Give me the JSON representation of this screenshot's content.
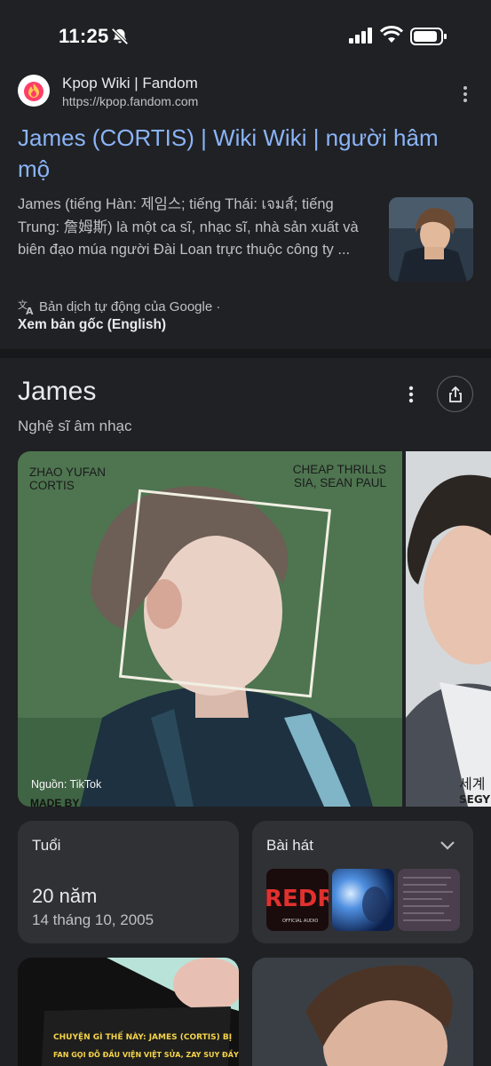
{
  "status_bar": {
    "time": "11:25",
    "icons": [
      "bell-off-icon",
      "signal-icon",
      "wifi-icon",
      "battery-icon"
    ]
  },
  "result": {
    "site_name": "Kpop Wiki | Fandom",
    "site_url": "https://kpop.fandom.com",
    "title": "James (CORTIS) | Wiki Wiki | người hâm mộ",
    "snippet": "James (tiếng Hàn: 제임스; tiếng Thái: เจมส์; tiếng Trung: 詹姆斯) là một ca sĩ, nhạc sĩ, nhà sản xuất và biên đạo múa người Đài Loan trực thuộc công ty ...",
    "translate_note": "Bản dịch tự động của Google ·",
    "original_link": "Xem bản gốc (English)"
  },
  "knowledge_panel": {
    "title": "James",
    "subtitle": "Nghệ sĩ âm nhạc",
    "main_image": {
      "label_left": [
        "ZHAO YUFAN",
        "CORTIS"
      ],
      "label_right": [
        "CHEAP THRILLS",
        "SIA, SEAN PAUL"
      ],
      "source": "Nguồn: TikTok",
      "made_by": "MADE BY"
    },
    "side_image": {
      "caption": [
        "세계",
        "SEGY"
      ]
    },
    "age": {
      "label": "Tuổi",
      "value": "20 năm",
      "birth_date": "14 tháng 10, 2005"
    },
    "songs": {
      "label": "Bài hát",
      "thumb1_text": "REDRE",
      "thumb1_sub": "OFFICIAL AUDIO"
    },
    "bottom_tile_caption": [
      "CHUYỆN GÌ THẾ NÀY: JAMES (CORTIS) BỊ",
      "FAN GỌI ĐỖ ĐẦU VIỆN VIỆT SỬA, ZAY SUY ĐẦY"
    ]
  },
  "colors": {
    "background": "#202124",
    "card": "#303134",
    "link": "#8ab4f8",
    "divider": "#17181a"
  }
}
